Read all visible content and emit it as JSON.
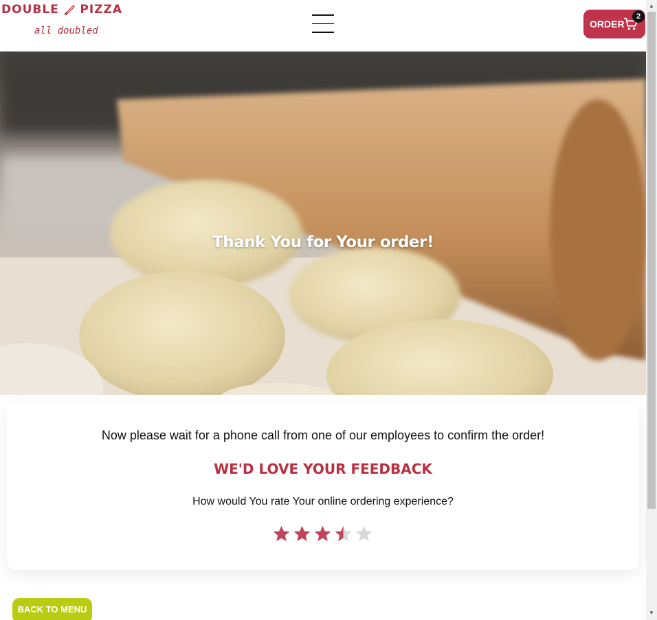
{
  "logo": {
    "name_left": "DOUBLE",
    "name_right": "PIZZA",
    "tagline": "all doubled"
  },
  "header": {
    "order_label": "ORDER",
    "cart_count": "2"
  },
  "hero": {
    "title": "Thank You for Your order!"
  },
  "card": {
    "message": "Now please wait for a phone call from one of our employees to confirm the order!",
    "heading": "WE'D LOVE YOUR FEEDBACK",
    "question": "How would You rate Your online ordering experience?",
    "rating": 3.5,
    "max_rating": 5
  },
  "footer": {
    "back_label": "BACK TO MENU"
  },
  "colors": {
    "brand": "#b8303f",
    "accent_green": "#b9cc12",
    "star_filled": "#c1455a",
    "star_empty": "#d9d9d9"
  },
  "icons": [
    "knife-icon",
    "hamburger-menu-icon",
    "cart-icon",
    "star-icon"
  ]
}
